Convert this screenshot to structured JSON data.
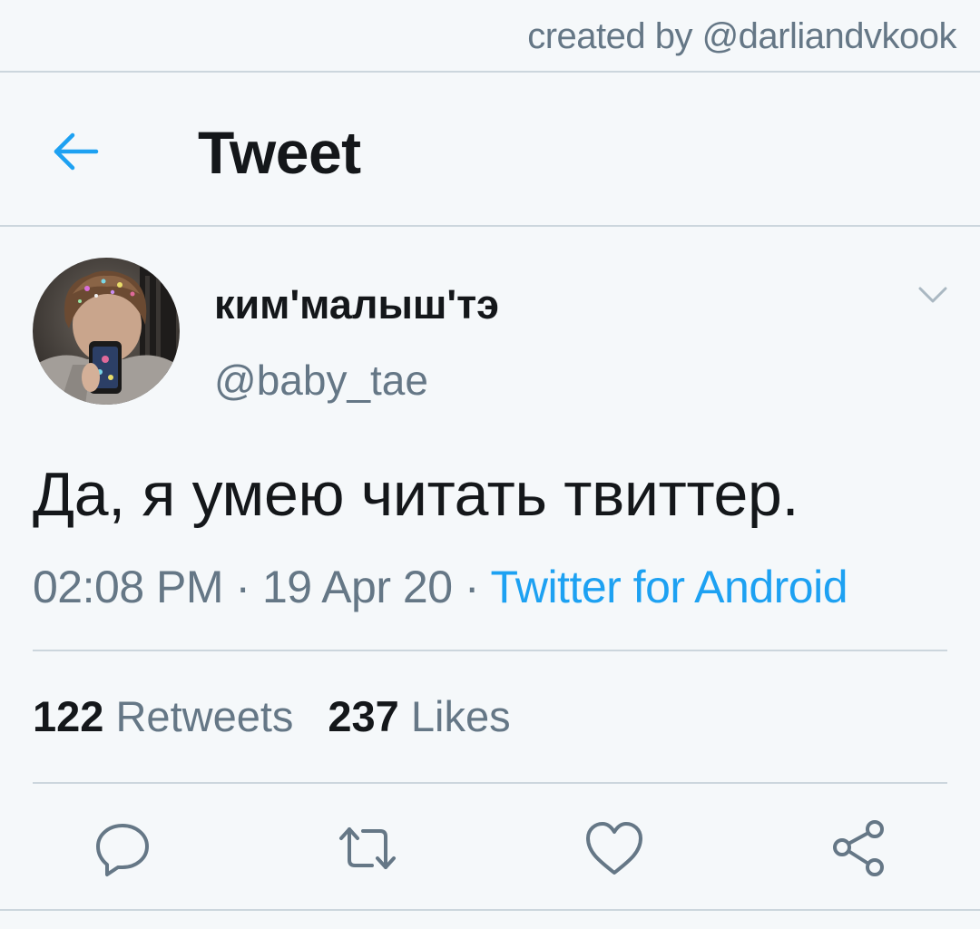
{
  "watermark": "created by @darliandvkook",
  "header": {
    "title": "Tweet"
  },
  "tweet": {
    "display_name": "ким'малыш'тэ",
    "handle": "@baby_tae",
    "text": "Да, я умею читать твиттер.",
    "time": "02:08 PM",
    "date": "19 Apr 20",
    "source": "Twitter for Android",
    "separator": " · ",
    "retweets_count": "122",
    "retweets_label": "Retweets",
    "likes_count": "237",
    "likes_label": "Likes"
  },
  "icons": {
    "back": "arrow-left-icon",
    "more": "chevron-down-icon",
    "reply": "reply-icon",
    "retweet": "retweet-icon",
    "like": "heart-icon",
    "share": "share-icon"
  },
  "colors": {
    "accent": "#1da1f2",
    "secondary_text": "#657786",
    "primary_text": "#14171a",
    "background": "#f5f8fa",
    "divider": "#ccd6dd"
  }
}
